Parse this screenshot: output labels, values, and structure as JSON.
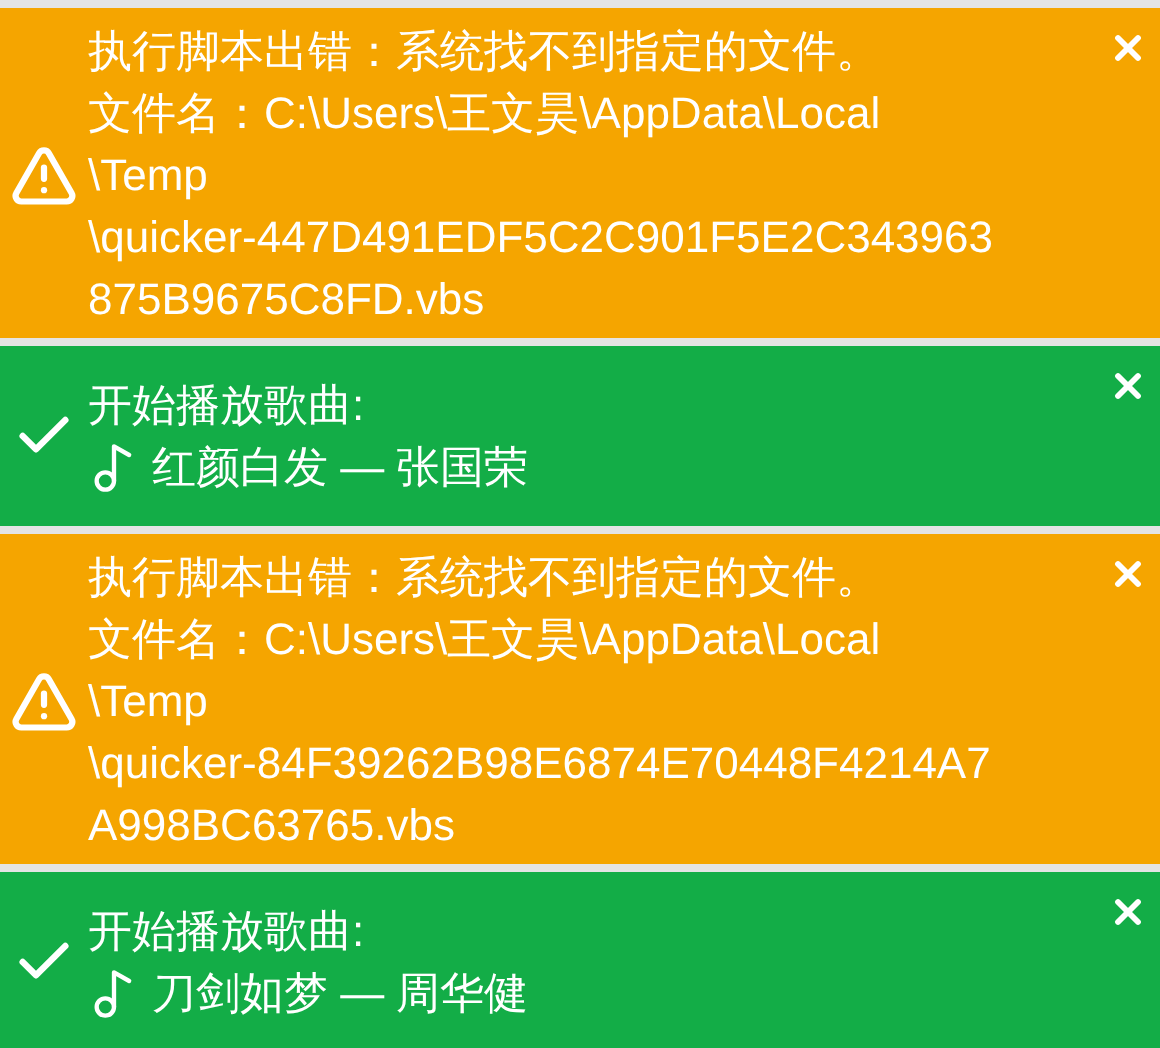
{
  "notifications": [
    {
      "kind": "error",
      "lines": [
        "执行脚本出错：系统找不到指定的文件。",
        "文件名：C:\\Users\\王文昊\\AppData\\Local",
        "\\Temp",
        "\\quicker-447D491EDF5C2C901F5E2C343963",
        "875B9675C8FD.vbs"
      ]
    },
    {
      "kind": "success",
      "lines": [
        "开始播放歌曲:"
      ],
      "song": "红颜白发 — 张国荣"
    },
    {
      "kind": "error",
      "lines": [
        "执行脚本出错：系统找不到指定的文件。",
        "文件名：C:\\Users\\王文昊\\AppData\\Local",
        "\\Temp",
        "\\quicker-84F39262B98E6874E70448F4214A7",
        "A998BC63765.vbs"
      ]
    },
    {
      "kind": "success",
      "lines": [
        "开始播放歌曲:"
      ],
      "song": "刀剑如梦 — 周华健"
    }
  ]
}
